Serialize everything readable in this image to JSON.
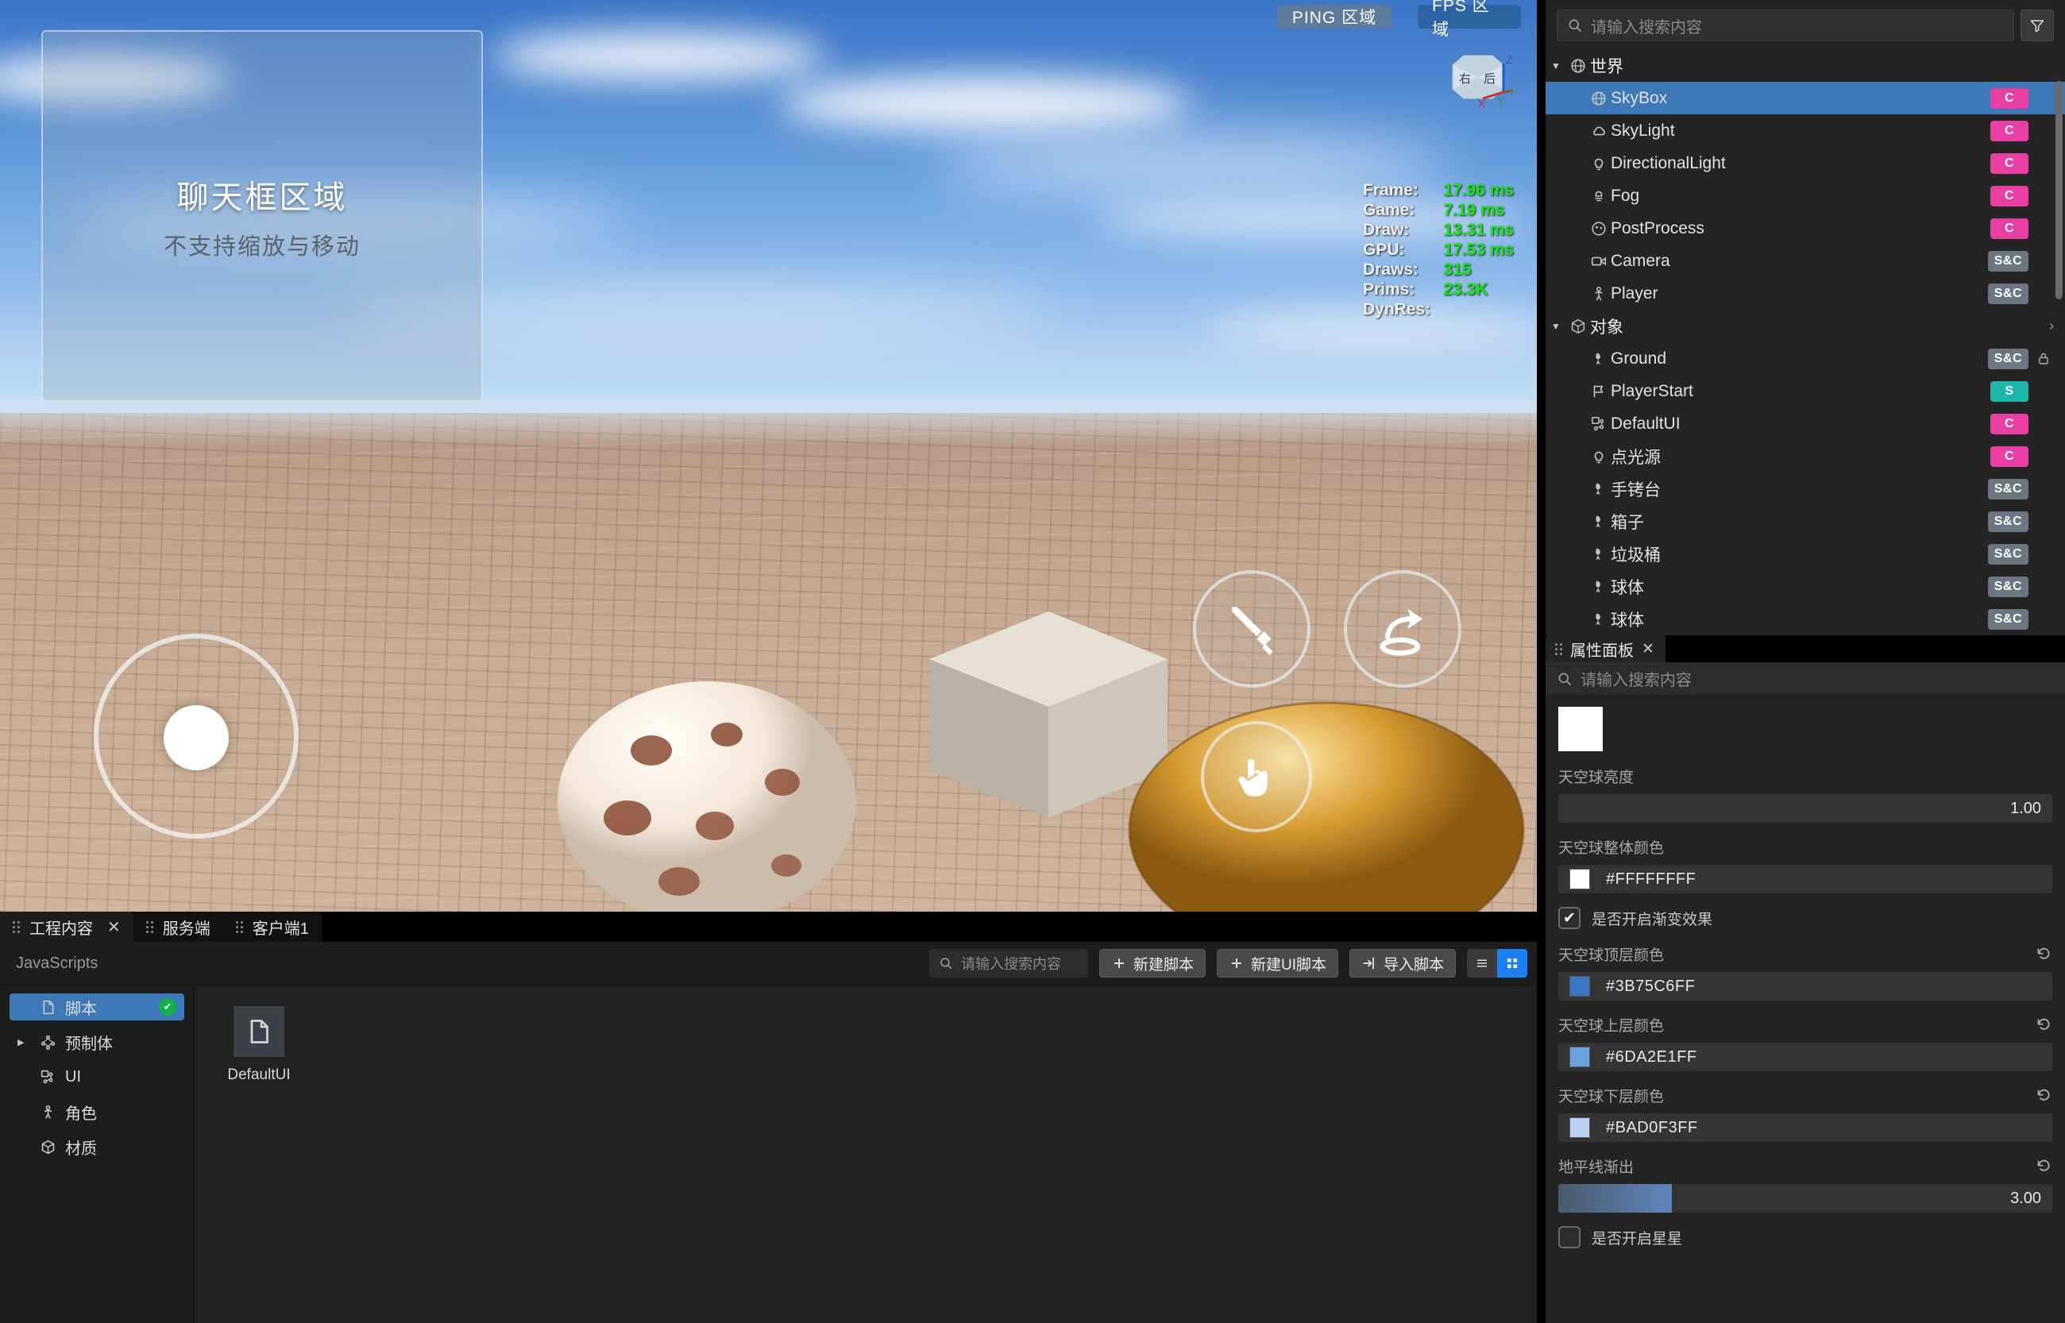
{
  "viewport": {
    "chat": {
      "title": "聊天框区域",
      "subtitle": "不支持缩放与移动"
    },
    "ping_badge": "PING 区域",
    "fps_badge": "FPS 区域",
    "stats": [
      {
        "key": "Frame:",
        "value": "17.96 ms"
      },
      {
        "key": "Game:",
        "value": "7.19 ms"
      },
      {
        "key": "Draw:",
        "value": "13.31 ms"
      },
      {
        "key": "GPU:",
        "value": "17.53 ms"
      },
      {
        "key": "Draws:",
        "value": "315"
      },
      {
        "key": "Prims:",
        "value": "23.3K"
      },
      {
        "key": "DynRes:",
        "value": ""
      }
    ],
    "viewcube": {
      "face_left": "右",
      "face_right": "后",
      "axis_x": "X",
      "axis_y": "Y",
      "axis_z": "Z"
    },
    "controls": {
      "joystick": "movement-joystick",
      "attack": "sword-icon",
      "jump": "jump-arrow-icon",
      "interact": "hand-icon"
    }
  },
  "outliner": {
    "search_placeholder": "请输入搜索内容",
    "filter_icon": "filter-icon",
    "groups": [
      {
        "label": "世界",
        "icon": "globe-icon",
        "expanded": true,
        "items": [
          {
            "label": "SkyBox",
            "icon": "globe-icon",
            "tag": "C",
            "tag_type": "c",
            "selected": true
          },
          {
            "label": "SkyLight",
            "icon": "cloud-icon",
            "tag": "C",
            "tag_type": "c",
            "selected": false
          },
          {
            "label": "DirectionalLight",
            "icon": "bulb-icon",
            "tag": "C",
            "tag_type": "c",
            "selected": false
          },
          {
            "label": "Fog",
            "icon": "fog-icon",
            "tag": "C",
            "tag_type": "c",
            "selected": false
          },
          {
            "label": "PostProcess",
            "icon": "palette-icon",
            "tag": "C",
            "tag_type": "c",
            "selected": false
          },
          {
            "label": "Camera",
            "icon": "camera-icon",
            "tag": "S&C",
            "tag_type": "sc",
            "selected": false
          },
          {
            "label": "Player",
            "icon": "person-icon",
            "tag": "S&C",
            "tag_type": "sc",
            "selected": false
          }
        ]
      },
      {
        "label": "对象",
        "icon": "cube-icon",
        "expanded": true,
        "chevron": "›",
        "items": [
          {
            "label": "Ground",
            "icon": "mesh-icon",
            "tag": "S&C",
            "tag_type": "sc",
            "locked": true,
            "selected": false
          },
          {
            "label": "PlayerStart",
            "icon": "flag-icon",
            "tag": "S",
            "tag_type": "s",
            "selected": false
          },
          {
            "label": "DefaultUI",
            "icon": "ui-icon",
            "tag": "C",
            "tag_type": "c",
            "selected": false
          },
          {
            "label": "点光源",
            "icon": "bulb-icon",
            "tag": "C",
            "tag_type": "c",
            "selected": false
          },
          {
            "label": "手铐台",
            "icon": "mesh-icon",
            "tag": "S&C",
            "tag_type": "sc",
            "selected": false
          },
          {
            "label": "箱子",
            "icon": "mesh-icon",
            "tag": "S&C",
            "tag_type": "sc",
            "selected": false
          },
          {
            "label": "垃圾桶",
            "icon": "mesh-icon",
            "tag": "S&C",
            "tag_type": "sc",
            "selected": false
          },
          {
            "label": "球体",
            "icon": "mesh-icon",
            "tag": "S&C",
            "tag_type": "sc",
            "selected": false
          },
          {
            "label": "球体",
            "icon": "mesh-icon",
            "tag": "S&C",
            "tag_type": "sc",
            "selected": false
          }
        ]
      }
    ]
  },
  "properties": {
    "tab_title": "属性面板",
    "close_icon": "close-icon",
    "search_placeholder": "请输入搜索内容",
    "preview_color": "#FFFFFF",
    "fields": [
      {
        "kind": "number",
        "label": "天空球亮度",
        "value": "1.00",
        "fill_pct": 0,
        "reset": false
      },
      {
        "kind": "color",
        "label": "天空球整体颜色",
        "value": "#FFFFFFFF",
        "swatch": "#FFFFFF",
        "reset": false
      },
      {
        "kind": "check",
        "label": "是否开启渐变效果",
        "checked": true
      },
      {
        "kind": "color",
        "label": "天空球顶层颜色",
        "value": "#3B75C6FF",
        "swatch": "#3B75C6",
        "reset": true
      },
      {
        "kind": "color",
        "label": "天空球上层颜色",
        "value": "#6DA2E1FF",
        "swatch": "#6DA2E1",
        "reset": true
      },
      {
        "kind": "color",
        "label": "天空球下层颜色",
        "value": "#BAD0F3FF",
        "swatch": "#BAD0F3",
        "reset": true
      },
      {
        "kind": "number",
        "label": "地平线渐出",
        "value": "3.00",
        "fill_pct": 23,
        "reset": true
      },
      {
        "kind": "check",
        "label": "是否开启星星",
        "checked": false
      }
    ],
    "reset_icon": "reset-icon"
  },
  "bottom": {
    "tabs": [
      {
        "label": "工程内容",
        "active": true,
        "closable": true
      },
      {
        "label": "服务端",
        "active": false,
        "closable": false
      },
      {
        "label": "客户端1",
        "active": false,
        "closable": false
      }
    ],
    "close_icon": "close-icon",
    "breadcrumb": "JavaScripts",
    "search_placeholder": "请输入搜索内容",
    "buttons": [
      {
        "label": "新建脚本",
        "icon": "plus-icon"
      },
      {
        "label": "新建UI脚本",
        "icon": "plus-icon"
      },
      {
        "label": "导入脚本",
        "icon": "import-icon"
      }
    ],
    "view_list_icon": "list-view-icon",
    "view_grid_icon": "grid-view-icon",
    "view_mode": "grid",
    "folders": [
      {
        "label": "脚本",
        "icon": "file-icon",
        "selected": true,
        "badge": "✔",
        "caret": ""
      },
      {
        "label": "预制体",
        "icon": "prefab-icon",
        "selected": false,
        "caret": "▶"
      },
      {
        "label": "UI",
        "icon": "ui-icon",
        "selected": false,
        "caret": ""
      },
      {
        "label": "角色",
        "icon": "person-icon",
        "selected": false,
        "caret": ""
      },
      {
        "label": "材质",
        "icon": "cube-icon",
        "selected": false,
        "caret": ""
      }
    ],
    "assets": [
      {
        "name": "DefaultUI",
        "icon": "file-icon"
      }
    ]
  },
  "colors": {
    "accent_blue": "#3d78b8",
    "tag_client": "#e83fa5",
    "tag_server": "#1eb6a6",
    "tag_both": "#6b7681",
    "toggle_on": "#1b7ff5",
    "ok_green": "#12b048",
    "stat_green": "#15e815"
  }
}
